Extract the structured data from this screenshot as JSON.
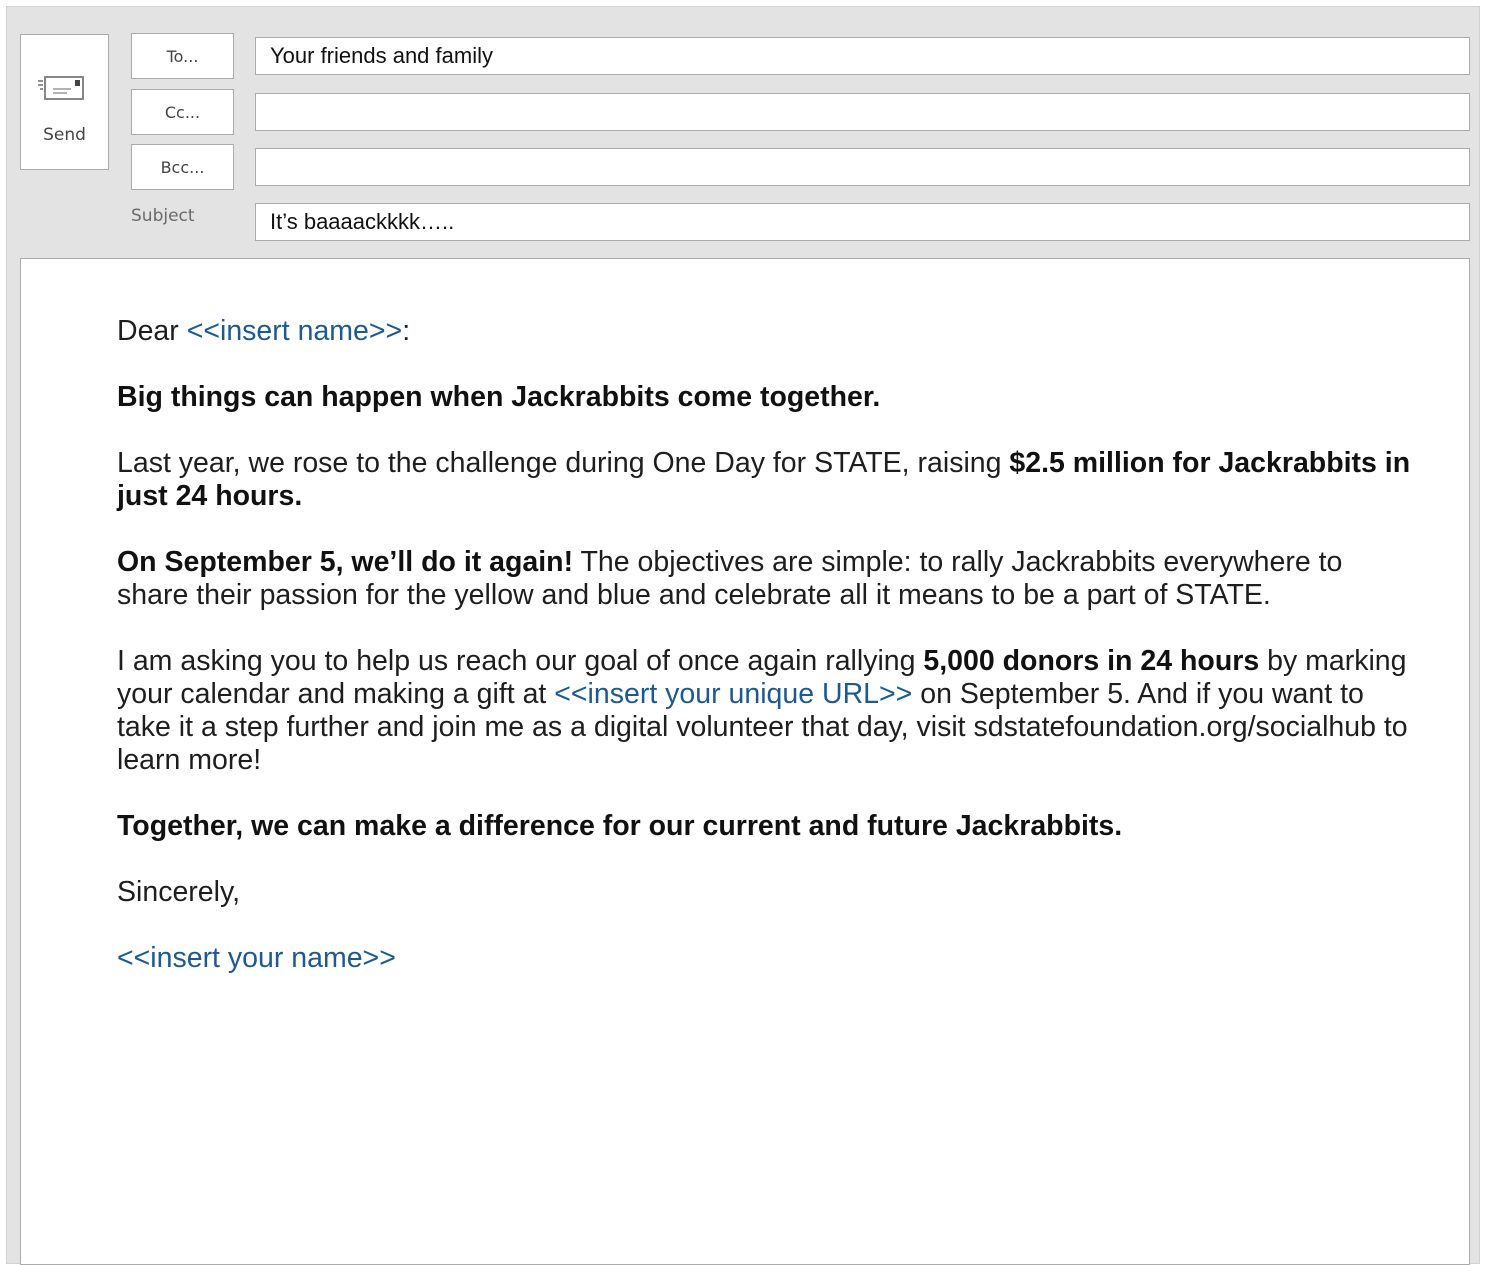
{
  "toolbar": {
    "send_label": "Send"
  },
  "header": {
    "to_button": "To...",
    "cc_button": "Cc...",
    "bcc_button": "Bcc...",
    "subject_label": "Subject",
    "to_value": "Your friends and family",
    "cc_value": "",
    "bcc_value": "",
    "subject_value": "It’s baaaackkkk….."
  },
  "message": {
    "greeting_prefix": "Dear ",
    "greeting_placeholder": "<<insert name>>",
    "greeting_suffix": ":",
    "headline": "Big things can happen when Jackrabbits come together.",
    "p1_text": "Last year, we rose to the challenge during One Day for STATE, raising ",
    "p1_bold": "$2.5 million for Jackrabbits in just 24 hours.",
    "p2_bold": "On September 5, we’ll do it again!",
    "p2_text": " The objectives are simple: to rally Jackrabbits everywhere to share their passion for the yellow and blue and celebrate all it means to be a part of STATE.",
    "p3_text1": "I am asking you to help us reach our goal of once again rallying ",
    "p3_bold": "5,000 donors in 24 hours",
    "p3_text2": " by marking your calendar and making a gift at ",
    "p3_placeholder": "<<insert your unique URL>>",
    "p3_text3": " on September 5. And if you want to take it a step further and join me as a digital volunteer that day, visit sdstatefoundation.org/socialhub to learn more!",
    "closing_headline": "Together, we can make a difference for our current and future Jackrabbits.",
    "signoff": "Sincerely,",
    "signature_placeholder": "<<insert your name>>"
  },
  "colors": {
    "placeholder": "#1c5a96",
    "frame": "#e3e3e3",
    "border": "#ababab"
  },
  "icons": {
    "send": "envelope-send-icon"
  }
}
